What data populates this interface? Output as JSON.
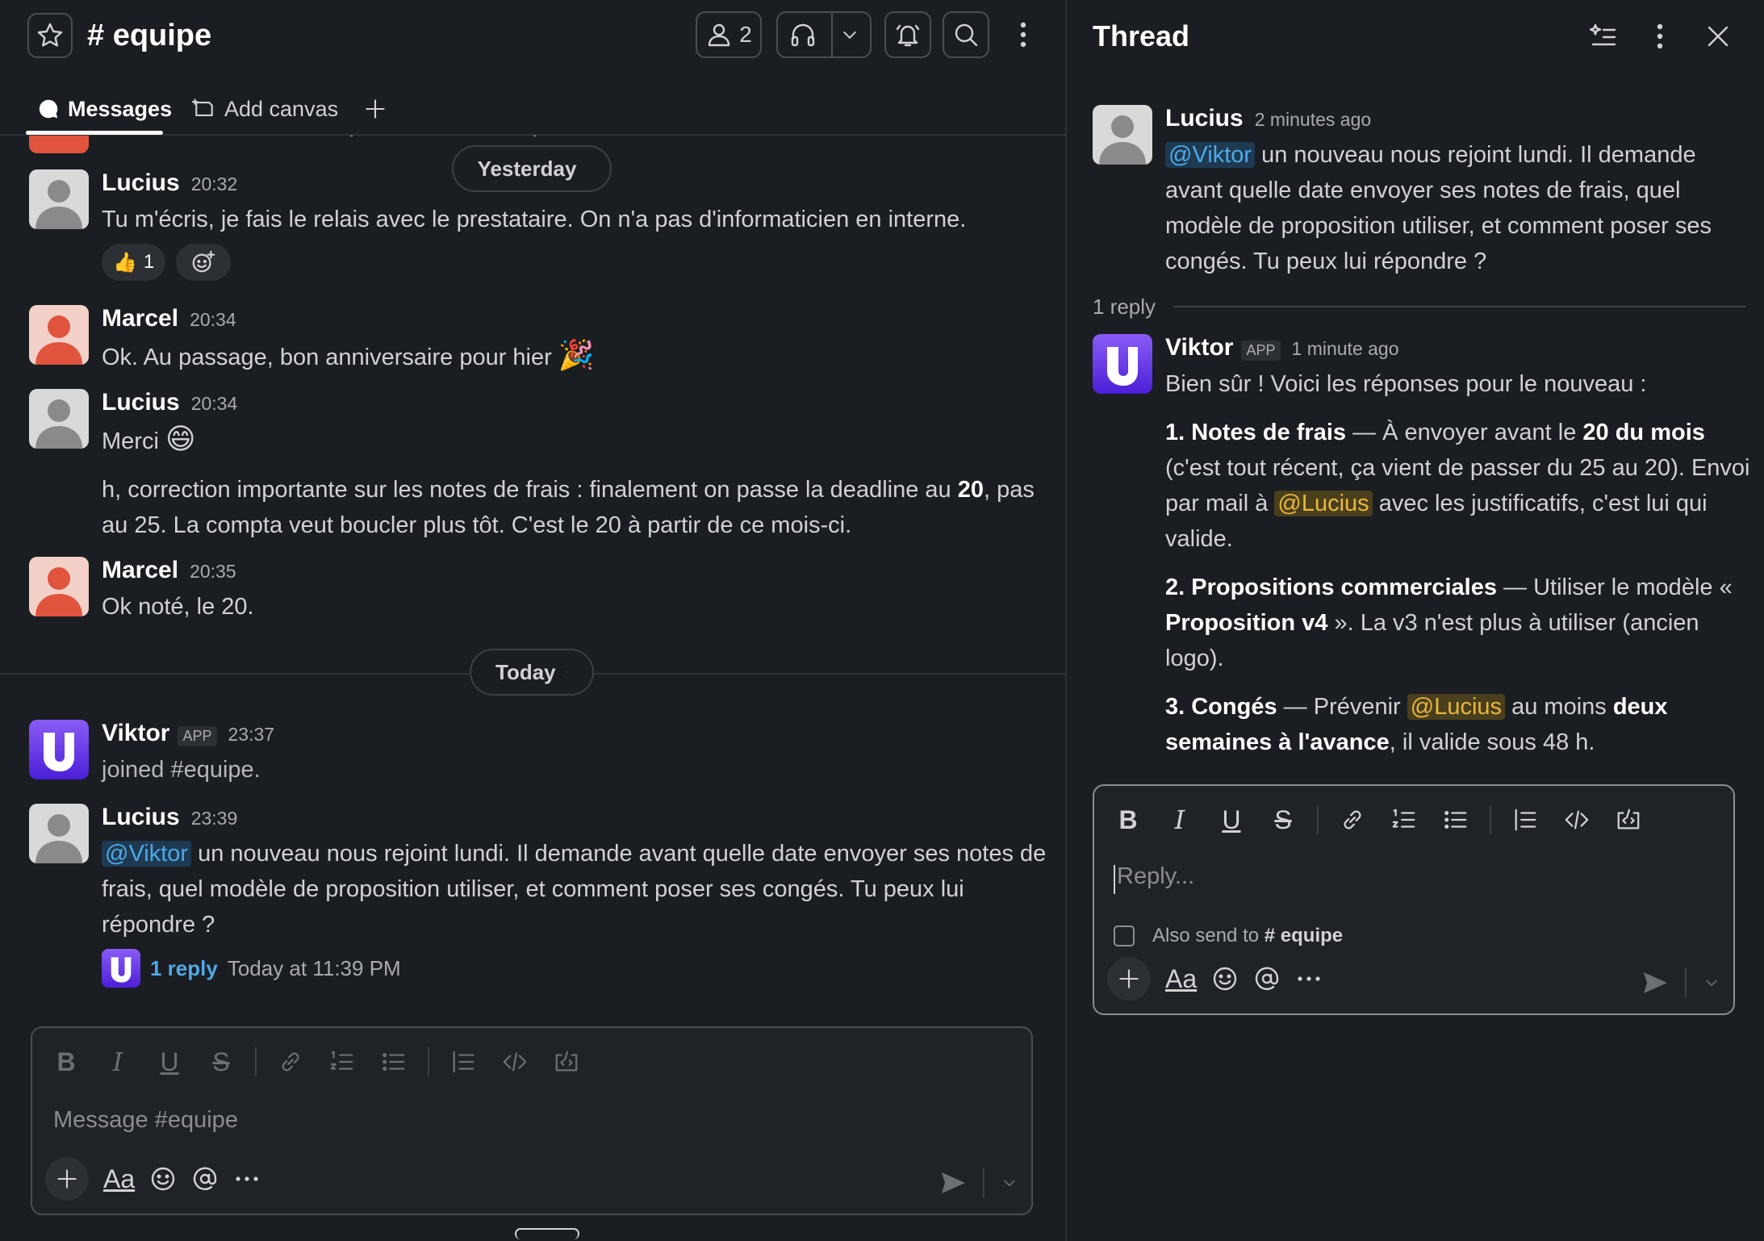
{
  "header": {
    "channel_name": "# equipe",
    "members_count": "2"
  },
  "tabs": [
    {
      "label": "Messages"
    },
    {
      "label": "Add canvas"
    }
  ],
  "feed": {
    "cut_top_text": "Pour un souci informatique, on voit avec qui ?",
    "separators": {
      "yesterday": "Yesterday",
      "today": "Today"
    },
    "messages": [
      {
        "author": "Lucius",
        "time": "20:32",
        "text": "Tu m'écris, je fais le relais avec le prestataire. On n'a pas d'informaticien en interne.",
        "reaction_emoji": "👍",
        "reaction_count": "1"
      },
      {
        "author": "Marcel",
        "time": "20:34",
        "text": "Ok. Au passage, bon anniversaire pour hier",
        "emoji": "🎉"
      },
      {
        "author": "Lucius",
        "time": "20:34",
        "text": "Merci",
        "emoji": "😄",
        "text2_a": "h, correction importante sur les notes de frais : finalement on passe la deadline au ",
        "text2_b": "20",
        "text2_c": ", pas au 25. La compta veut boucler plus tôt. C'est le 20 à partir de ce mois-ci."
      },
      {
        "author": "Marcel",
        "time": "20:35",
        "text": "Ok noté, le 20."
      },
      {
        "author": "Viktor",
        "app_tag": "APP",
        "time": "23:37",
        "text": "joined #equipe."
      },
      {
        "author": "Lucius",
        "time": "23:39",
        "mention": "@Viktor",
        "text": " un nouveau nous rejoint lundi. Il demande avant quelle date envoyer ses notes de frais, quel modèle de proposition utiliser, et comment poser ses congés. Tu peux lui répondre ?",
        "reply_link": "1 reply",
        "reply_time": "Today at 11:39 PM"
      }
    ]
  },
  "composer": {
    "placeholder": "Message #equipe",
    "aa_label": "Aa"
  },
  "thread": {
    "title": "Thread",
    "parent": {
      "author": "Lucius",
      "time": "2 minutes ago",
      "mention": "@Viktor",
      "text": " un nouveau nous rejoint lundi. Il demande avant quelle date envoyer ses notes de frais, quel modèle de proposition utiliser, et comment poser ses congés. Tu peux lui répondre ?"
    },
    "reply_count": "1 reply",
    "reply": {
      "author": "Viktor",
      "app_tag": "APP",
      "time": "1 minute ago",
      "intro": "Bien sûr ! Voici les réponses pour le nouveau :",
      "p1_b1": "1. Notes de frais",
      "p1_t1": " — À envoyer avant le ",
      "p1_b2": "20 du mois",
      "p1_t2": " (c'est tout récent, ça vient de passer du 25 au 20). Envoi par mail à ",
      "p1_mention": "@Lucius",
      "p1_t3": " avec les justificatifs, c'est lui qui valide.",
      "p2_b1": "2. Propositions commerciales",
      "p2_t1": " — Utiliser le modèle « ",
      "p2_b2": "Proposition v4",
      "p2_t2": " ». La v3 n'est plus à utiliser (ancien logo).",
      "p3_b1": "3. Congés",
      "p3_t1": " — Prévenir ",
      "p3_mention": "@Lucius",
      "p3_t2": " au moins ",
      "p3_b2": "deux semaines à l'avance",
      "p3_t3": ", il valide sous 48 h."
    },
    "composer": {
      "placeholder": "Reply...",
      "also_send": "Also send to",
      "also_channel": "# equipe",
      "aa_label": "Aa"
    }
  },
  "colors": {
    "background": "#1a1d21",
    "mention_blue": "#4fa9e6",
    "mention_yellow": "#e8b73c",
    "avatar_marcel": "#e0533d",
    "avatar_viktor": "#6a3df0"
  }
}
